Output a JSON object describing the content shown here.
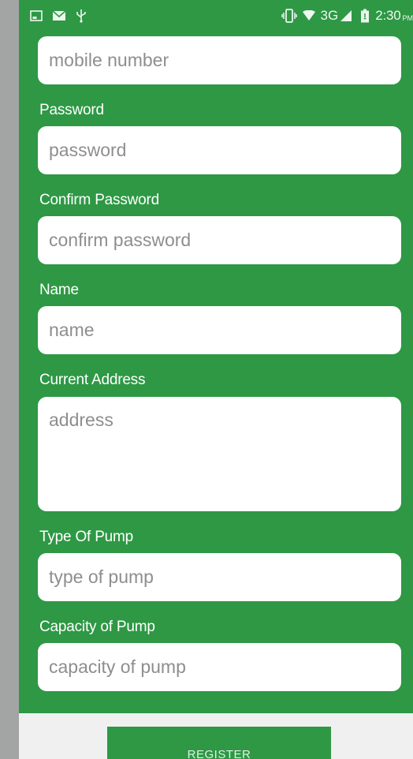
{
  "status_bar": {
    "time": "2:30",
    "ampm": "PM",
    "network": "3G",
    "icons": [
      "image-icon",
      "mail-icon",
      "usb-icon",
      "vibrate-icon",
      "wifi-icon",
      "signal-icon",
      "battery-icon"
    ]
  },
  "form": {
    "mobile": {
      "placeholder": "mobile number",
      "value": ""
    },
    "password": {
      "label": "Password",
      "placeholder": "password",
      "value": ""
    },
    "confirm_password": {
      "label": "Confirm Password",
      "placeholder": "confirm password",
      "value": ""
    },
    "name": {
      "label": "Name",
      "placeholder": "name",
      "value": ""
    },
    "address": {
      "label": "Current Address",
      "placeholder": "address",
      "value": ""
    },
    "pump_type": {
      "label": "Type Of Pump",
      "placeholder": "type of pump",
      "value": ""
    },
    "pump_capacity": {
      "label": "Capacity of Pump",
      "placeholder": "capacity of pump",
      "value": ""
    }
  },
  "footer": {
    "register_label": "REGISTER"
  },
  "colors": {
    "primary_green": "#2e9845",
    "side_gray": "#a2a5a4",
    "field_bg": "#ffffff",
    "placeholder": "#8e8e8e",
    "footer_bg": "#eff0ef"
  }
}
